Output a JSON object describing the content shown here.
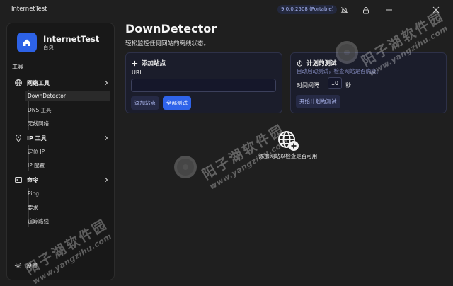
{
  "window": {
    "title": "InternetTest",
    "version": "9.0.0.2508 (Portable)"
  },
  "sidebar": {
    "app_name": "InternetTest",
    "app_sub": "首页",
    "section": "工具",
    "groups": [
      {
        "label": "网络工具",
        "items": [
          "DownDetector",
          "DNS 工具",
          "无线网络"
        ]
      },
      {
        "label": "IP 工具",
        "items": [
          "定位 IP",
          "IP 配置"
        ]
      },
      {
        "label": "命令",
        "items": [
          "Ping",
          "要求",
          "追踪路线"
        ]
      }
    ],
    "active_item": "DownDetector",
    "settings": "设置"
  },
  "main": {
    "title": "DownDetector",
    "subtitle": "轻松监控任何网站的离线状态。",
    "add_card": {
      "title": "添加站点",
      "url_label": "URL",
      "url_value": "",
      "add_button": "添加站点",
      "test_all_button": "全部测试"
    },
    "schedule_card": {
      "title": "计划的测试",
      "hint": "自动启动测试，检查网站是否确康。",
      "interval_label": "时间间隔",
      "interval_value": "10",
      "interval_unit": "秒",
      "start_button": "开始计划的测试"
    },
    "empty_state": "添加网站以检查是否可用"
  },
  "watermark": {
    "text": "阳子湖软件园",
    "url": "www.yangzihu.com"
  },
  "colors": {
    "accent": "#2f63ea",
    "background": "#1f1f1f",
    "card": "#1b1d2b"
  }
}
